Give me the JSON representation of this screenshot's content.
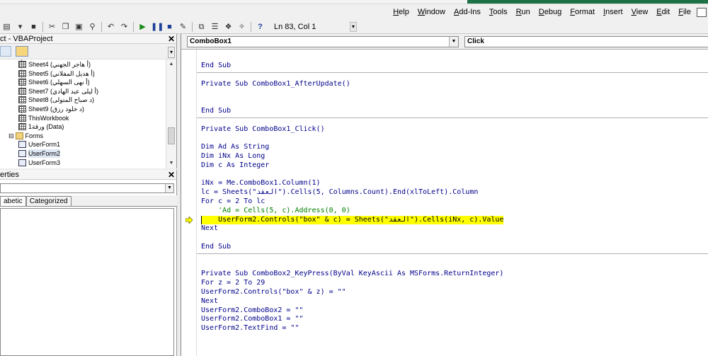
{
  "menu": {
    "items": [
      "Help",
      "Window",
      "Add-Ins",
      "Tools",
      "Run",
      "Debug",
      "Format",
      "Insert",
      "View",
      "Edit",
      "File"
    ]
  },
  "toolbar": {
    "position": "Ln 83, Col 1"
  },
  "project": {
    "title": "ct - VBAProject",
    "nodes": [
      {
        "name": "Sheet4 (أ هاجر الجهني)",
        "type": "sheet"
      },
      {
        "name": "Sheet5 (أ هديل المفلاني)",
        "type": "sheet"
      },
      {
        "name": "Sheet6 (أ نهى السهلي)",
        "type": "sheet"
      },
      {
        "name": "Sheet7 (أ ليلى عبد الهادي)",
        "type": "sheet"
      },
      {
        "name": "Sheet8 (د صباح المتولى)",
        "type": "sheet"
      },
      {
        "name": "Sheet9 (د خلود رزق)",
        "type": "sheet"
      },
      {
        "name": "ThisWorkbook",
        "type": "sheet"
      },
      {
        "name": "ورقة1 (Data)",
        "type": "sheet"
      },
      {
        "name": "Forms",
        "type": "folder"
      },
      {
        "name": "UserForm1",
        "type": "form"
      },
      {
        "name": "UserForm2",
        "type": "form",
        "selected": true
      },
      {
        "name": "UserForm3",
        "type": "form"
      }
    ]
  },
  "properties": {
    "title": "erties",
    "tab_alpha": "abetic",
    "tab_cat": "Categorized"
  },
  "code": {
    "object": "ComboBox1",
    "procedure": "Click",
    "lines": [
      {
        "t": "End Sub",
        "c": "kw"
      },
      {
        "t": "",
        "c": ""
      },
      {
        "t": "Private Sub ComboBox1_AfterUpdate()",
        "c": "kw"
      },
      {
        "t": "",
        "c": ""
      },
      {
        "t": "",
        "c": ""
      },
      {
        "t": "End Sub",
        "c": "kw"
      },
      {
        "t": "",
        "c": ""
      },
      {
        "t": "Private Sub ComboBox1_Click()",
        "c": "kw"
      },
      {
        "t": "",
        "c": ""
      },
      {
        "t": "Dim Ad As String",
        "c": "kw"
      },
      {
        "t": "Dim iNx As Long",
        "c": "kw"
      },
      {
        "t": "Dim c As Integer",
        "c": "kw"
      },
      {
        "t": "",
        "c": ""
      },
      {
        "t": "iNx = Me.ComboBox1.Column(1)",
        "c": "kw"
      },
      {
        "t": "lc = Sheets(\"العقد\").Cells(5, Columns.Count).End(xlToLeft).Column",
        "c": "kw"
      },
      {
        "t": "For c = 2 To lc",
        "c": "kw"
      },
      {
        "t": "    'Ad = Cells(5, c).Address(0, 0)",
        "c": "cm"
      },
      {
        "t": "    UserForm2.Controls(\"box\" & c) = Sheets(\"العقد\").Cells(iNx, c).Value",
        "c": "hl"
      },
      {
        "t": "Next",
        "c": "kw"
      },
      {
        "t": "",
        "c": ""
      },
      {
        "t": "End Sub",
        "c": "kw"
      },
      {
        "t": "",
        "c": ""
      },
      {
        "t": "",
        "c": ""
      },
      {
        "t": "Private Sub ComboBox2_KeyPress(ByVal KeyAscii As MSForms.ReturnInteger)",
        "c": "kw"
      },
      {
        "t": "For z = 2 To 29",
        "c": "kw"
      },
      {
        "t": "UserForm2.Controls(\"box\" & z) = \"\"",
        "c": "kw"
      },
      {
        "t": "Next",
        "c": "kw"
      },
      {
        "t": "UserForm2.ComboBox2 = \"\"",
        "c": "kw"
      },
      {
        "t": "UserForm2.ComboBox1 = \"\"",
        "c": "kw"
      },
      {
        "t": "UserForm2.TextFind = \"\"",
        "c": "kw"
      }
    ]
  }
}
